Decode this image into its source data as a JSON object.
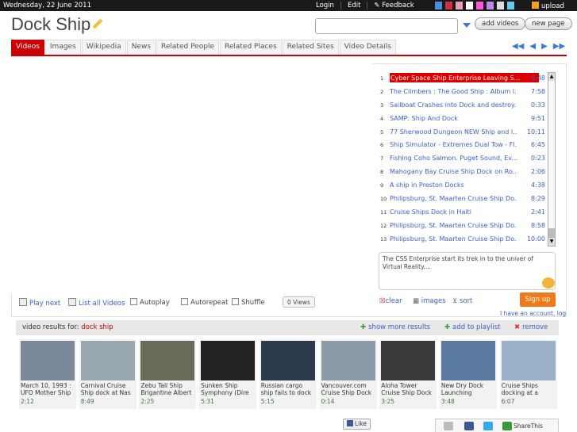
{
  "topbar": {
    "date": "Wednesday, 22 June 2011",
    "login": "Login",
    "edit": "Edit",
    "feedback": "Feedback",
    "upload": "upload",
    "swatches": [
      "#4a90d9",
      "#cc3344",
      "#e8a0b0",
      "#ffffff",
      "#ff55dd",
      "#bb88ee",
      "#dddddd",
      "#66ccee"
    ]
  },
  "header": {
    "title": "Dock Ship",
    "add_videos": "add videos",
    "new_page": "new page"
  },
  "tabs": [
    "Videos",
    "Images",
    "Wikipedia",
    "News",
    "Related People",
    "Related Places",
    "Related Sites",
    "Video Details"
  ],
  "playlist": [
    {
      "num": "1",
      "title": "Cyber Space Ship Enterprise Leaving S...",
      "dur": "0:48"
    },
    {
      "num": "2",
      "title": "The Climbers : The Good Ship : Album l...",
      "dur": "7:58"
    },
    {
      "num": "3",
      "title": "Sailboat Crashes into Dock and destroy...",
      "dur": "0:33"
    },
    {
      "num": "4",
      "title": "SAMP: Ship And Dock",
      "dur": "9:51"
    },
    {
      "num": "5",
      "title": "77 Sherwood Dungeon NEW Ship and l...",
      "dur": "10:11"
    },
    {
      "num": "6",
      "title": "Ship Simulator - Extremes Dual Tow - Fl...",
      "dur": "6:45"
    },
    {
      "num": "7",
      "title": "Fishing Coho Salmon. Puget Sound, Ev...",
      "dur": "0:23"
    },
    {
      "num": "8",
      "title": "Mahogany Bay Cruise Ship Dock on Ro...",
      "dur": "2:06"
    },
    {
      "num": "9",
      "title": "A ship in Preston Docks",
      "dur": "4:38"
    },
    {
      "num": "10",
      "title": "Philipsburg, St. Maarten Cruise Ship Do...",
      "dur": "8:29"
    },
    {
      "num": "11",
      "title": "Cruise Ships Dock in Haiti",
      "dur": "2:41"
    },
    {
      "num": "12",
      "title": "Philipsburg, St. Maarten Cruise Ship Do...",
      "dur": "8:58"
    },
    {
      "num": "13",
      "title": "Philipsburg, St. Maarten Cruise Ship Do...",
      "dur": "10:00"
    }
  ],
  "description": "The CSS Enterprise start its trek in to the univer of Virtual Reality....",
  "controls": {
    "play_next": "Play next",
    "list_all": "List all Videos",
    "autoplay": "Autoplay",
    "autorepeat": "Autorepeat",
    "shuffle": "Shuffle",
    "views": "0 Views",
    "clear": "clear",
    "images": "images",
    "sort": "sort",
    "signup": "Sign up",
    "account": "I have an account, log"
  },
  "results": {
    "label": "video results for:",
    "query": "dock ship",
    "show_more": "show more results",
    "add_playlist": "add to playlist",
    "remove": "remove"
  },
  "thumbs": [
    {
      "title": "March 10, 1993 : UFO Mother Ship",
      "dur": "2:12",
      "color": "#7a8a9a"
    },
    {
      "title": "Carnival Cruise Ship dock at Nas",
      "dur": "8:49",
      "color": "#9aa8b0"
    },
    {
      "title": "Zebu Tall Ship Brigantine Albert",
      "dur": "2:25",
      "color": "#6a6a5a"
    },
    {
      "title": "Sunken Ship Symphony (Dire",
      "dur": "5:31",
      "color": "#222222"
    },
    {
      "title": "Russian cargo ship fails to dock",
      "dur": "5:15",
      "color": "#2a3a4a"
    },
    {
      "title": "Vancouver.com Cruise Ship Dock",
      "dur": "0:14",
      "color": "#8a9aa8"
    },
    {
      "title": "Aloha Tower Cruise Ship Dock",
      "dur": "3:25",
      "color": "#3a3a3a"
    },
    {
      "title": "New Dry Dock Launching",
      "dur": "3:48",
      "color": "#5a7aa0"
    },
    {
      "title": "Cruise Ships docking at a",
      "dur": "6:07",
      "color": "#9ab0c8"
    }
  ],
  "footer": {
    "like": "Like",
    "share": "ShareThis"
  }
}
